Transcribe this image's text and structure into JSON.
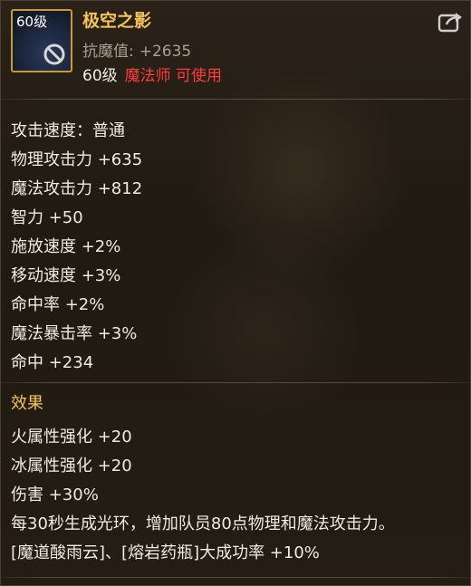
{
  "item": {
    "icon_level": "60级",
    "name": "极空之影",
    "main_stat_label": "抗魔值:",
    "main_stat_value": "+2635",
    "required_level": "60级",
    "required_class": "魔法师 可使用"
  },
  "attributes": [
    "攻击速度：普通",
    "物理攻击力 +635",
    "魔法攻击力 +812",
    "智力 +50",
    "施放速度 +2%",
    "移动速度 +3%",
    "命中率 +2%",
    "魔法暴击率 +3%",
    "命中 +234"
  ],
  "effects": {
    "title": "效果",
    "lines": [
      "火属性强化 +20",
      "冰属性强化 +20",
      "伤害 +30%",
      "每30秒生成光环，增加队员80点物理和魔法攻击力。",
      "[魔道酸雨云]、[熔岩药瓶]大成功率 +10%"
    ]
  },
  "icons": {
    "share": "share-icon",
    "restriction": "no-entry-icon"
  },
  "colors": {
    "name": "#f5c45a",
    "class_restriction": "#ff3b3b",
    "text": "#f0ebe2",
    "muted": "#a8a094"
  }
}
